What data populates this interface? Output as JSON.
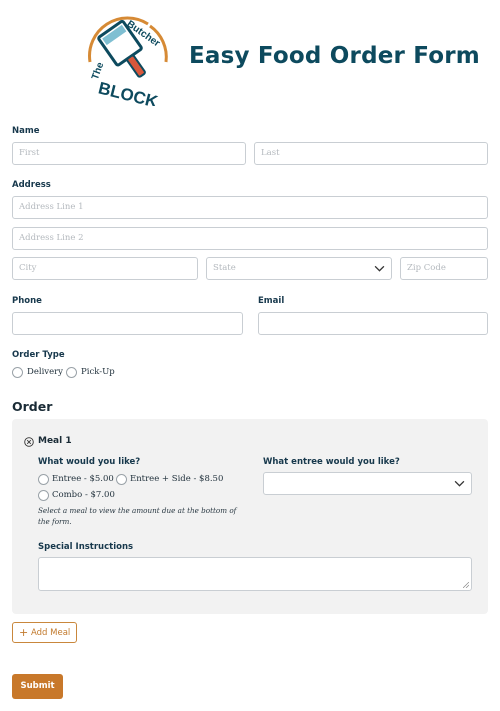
{
  "header": {
    "logo": {
      "line1": "The",
      "line2": "Butcher",
      "line3": "BLOCK",
      "icon": "cleaver-icon"
    },
    "title": "Easy Food Order Form"
  },
  "name": {
    "label": "Name",
    "first_placeholder": "First",
    "last_placeholder": "Last"
  },
  "address": {
    "label": "Address",
    "line1_placeholder": "Address Line 1",
    "line2_placeholder": "Address Line 2",
    "city_placeholder": "City",
    "state_placeholder": "State",
    "zip_placeholder": "Zip Code"
  },
  "phone": {
    "label": "Phone",
    "value": ""
  },
  "email": {
    "label": "Email",
    "value": ""
  },
  "order_type": {
    "label": "Order Type",
    "options": [
      "Delivery",
      "Pick-Up"
    ]
  },
  "order": {
    "heading": "Order",
    "meal": {
      "title": "Meal 1",
      "question": "What would you like?",
      "options": [
        "Entree - $5.00",
        "Entree + Side - $8.50",
        "Combo - $7.00"
      ],
      "help": "Select a meal to view the amount due at the bottom of the form.",
      "entree_question": "What entree would you like?",
      "entree_value": "",
      "instructions_label": "Special Instructions",
      "instructions_value": ""
    }
  },
  "actions": {
    "add_meal": "Add Meal",
    "submit": "Submit"
  },
  "colors": {
    "accent": "#c8782a",
    "title": "#0d4a5e",
    "card": "#f2f2f2"
  }
}
